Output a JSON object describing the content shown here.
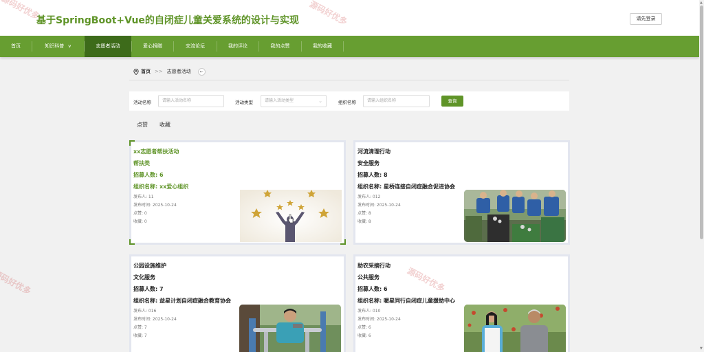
{
  "header": {
    "title": "基于SpringBoot+Vue的自闭症儿童关爱系统的设计与实现",
    "login_label": "请先登录"
  },
  "nav": {
    "items": [
      {
        "label": "首页",
        "active": false
      },
      {
        "label": "知识科普",
        "active": false,
        "has_dropdown": true
      },
      {
        "label": "志愿者活动",
        "active": true
      },
      {
        "label": "爱心捐赠",
        "active": false
      },
      {
        "label": "交流论坛",
        "active": false
      },
      {
        "label": "我的评论",
        "active": false
      },
      {
        "label": "我的点赞",
        "active": false
      },
      {
        "label": "我的收藏",
        "active": false
      }
    ],
    "dropdown_icon": "chevron-down-icon"
  },
  "breadcrumb": {
    "home": "首页",
    "separator": ">>",
    "current": "志愿者活动",
    "back_icon": "back-arrow-icon"
  },
  "search": {
    "name_label": "活动名称",
    "name_placeholder": "请输入活动名称",
    "type_label": "活动类型",
    "type_placeholder": "请输入活动类型",
    "org_label": "组织名称",
    "org_placeholder": "请输入组织名称",
    "button_label": "查询"
  },
  "sort": {
    "likes_label": "点赞",
    "favorites_label": "收藏"
  },
  "activities": [
    {
      "title": "xx志愿者帮扶活动",
      "type": "帮扶类",
      "recruit": "招募人数: 6",
      "org": "组织名称: xx爱心组织",
      "publisher": "发布人: 11",
      "time": "发布时间: 2025-10-24",
      "likes": "点赞: 0",
      "favorites": "收藏: 0",
      "highlighted": true
    },
    {
      "title": "河流清理行动",
      "type": "安全服务",
      "recruit": "招募人数: 8",
      "org": "组织名称: 星桥连接自闭症融合促进协会",
      "publisher": "发布人: 012",
      "time": "发布时间: 2025-10-24",
      "likes": "点赞: 8",
      "favorites": "收藏: 8",
      "highlighted": false
    },
    {
      "title": "公园设施维护",
      "type": "文化服务",
      "recruit": "招募人数: 7",
      "org": "组织名称: 益星计划自闭症融合教育协会",
      "publisher": "发布人: 016",
      "time": "发布时间: 2025-10-24",
      "likes": "点赞: 7",
      "favorites": "收藏: 7",
      "highlighted": false
    },
    {
      "title": "助农采摘行动",
      "type": "公共服务",
      "recruit": "招募人数: 6",
      "org": "组织名称: 暖星同行自闭症儿童援助中心",
      "publisher": "发布人: 010",
      "time": "发布时间: 2025-10-24",
      "likes": "点赞: 6",
      "favorites": "收藏: 6",
      "highlighted": false
    }
  ],
  "watermark": "源码好优多",
  "colors": {
    "brand": "#5f9428",
    "nav_bg": "#679e31",
    "nav_active": "#3d6b1a"
  }
}
